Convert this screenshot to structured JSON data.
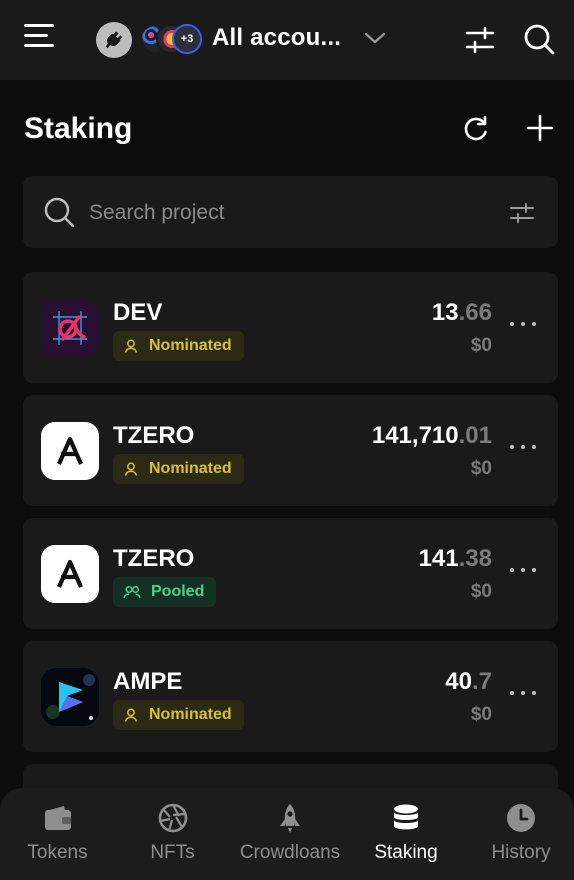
{
  "header": {
    "account_name": "All accou...",
    "extra_accounts_badge": "+3",
    "menu_icon": "hamburger-menu-icon",
    "connect_icon": "plug-icon",
    "filter_icon": "sliders-icon",
    "search_icon": "search-icon"
  },
  "page": {
    "title": "Staking",
    "reload_icon": "reload-icon",
    "add_icon": "plus-icon"
  },
  "search": {
    "placeholder": "Search project",
    "value": ""
  },
  "staking_items": [
    {
      "name": "DEV",
      "status": "Nominated",
      "amount_int": "13",
      "amount_frac": ".66",
      "fiat": "$0",
      "logo": "dev-logo-icon"
    },
    {
      "name": "TZERO",
      "status": "Nominated",
      "amount_int": "141,710",
      "amount_frac": ".01",
      "fiat": "$0",
      "logo": "aleph-zero-logo-icon"
    },
    {
      "name": "TZERO",
      "status": "Pooled",
      "amount_int": "141",
      "amount_frac": ".38",
      "fiat": "$0",
      "logo": "aleph-zero-logo-icon"
    },
    {
      "name": "AMPE",
      "status": "Nominated",
      "amount_int": "40",
      "amount_frac": ".7",
      "fiat": "$0",
      "logo": "ampe-logo-icon"
    }
  ],
  "bottom_nav": [
    {
      "label": "Tokens",
      "icon": "wallet-icon",
      "active": false
    },
    {
      "label": "NFTs",
      "icon": "aperture-icon",
      "active": false
    },
    {
      "label": "Crowdloans",
      "icon": "rocket-icon",
      "active": false
    },
    {
      "label": "Staking",
      "icon": "database-icon",
      "active": true
    },
    {
      "label": "History",
      "icon": "clock-icon",
      "active": false
    }
  ],
  "colors": {
    "background": "#0c0c0c",
    "surface": "#1a1a1a",
    "nominated": "#d9c033",
    "pooled": "#4ccf8e",
    "muted": "#7b7b7b"
  }
}
